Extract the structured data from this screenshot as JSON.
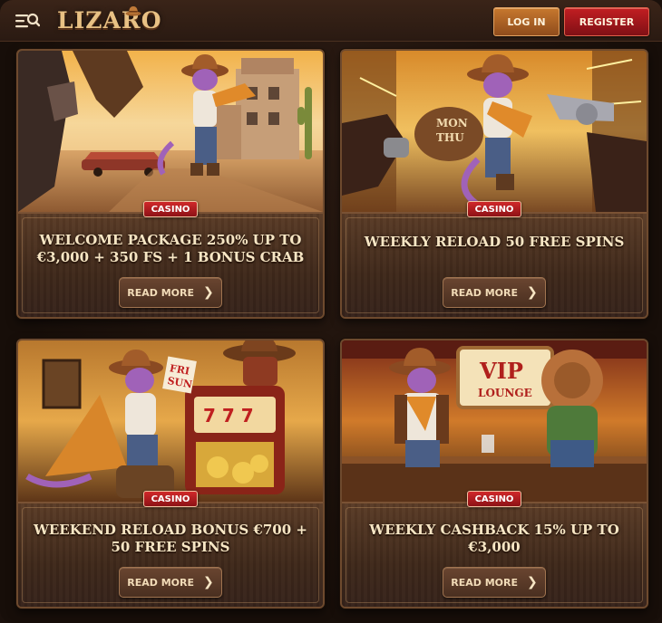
{
  "header": {
    "logo_text": "LIZARO",
    "login_label": "LOG IN",
    "register_label": "REGISTER",
    "menu_icon": "menu-search-icon",
    "logo_hat_icon": "cowboy-hat-icon"
  },
  "promos": [
    {
      "badge": "CASINO",
      "title": "WELCOME PACKAGE 250% UP TO €3,000 + 350 FS + 1 BONUS CRAB",
      "cta": "READ MORE",
      "art": "lizard-cowboy-desert-street"
    },
    {
      "badge": "CASINO",
      "title": "WEEKLY RELOAD 50 FREE SPINS",
      "cta": "READ MORE",
      "art": "lizard-cowboy-revolver-showdown",
      "art_text": [
        "MON",
        "THU"
      ]
    },
    {
      "badge": "CASINO",
      "title": "WEEKEND RELOAD BONUS €700 + 50 FREE SPINS",
      "cta": "READ MORE",
      "art": "lizard-cowboy-slot-machine",
      "art_text": [
        "FRI",
        "SUN"
      ]
    },
    {
      "badge": "CASINO",
      "title": "WEEKLY CASHBACK 15% UP TO €3,000",
      "cta": "READ MORE",
      "art": "lizard-cowboys-vip-lounge-bar",
      "art_text": [
        "VIP",
        "LOUNGE"
      ]
    }
  ],
  "colors": {
    "background": "#1a100b",
    "login": "#b8692a",
    "register": "#b0181c",
    "badge": "#c0201f",
    "title": "#f7e6c4"
  }
}
